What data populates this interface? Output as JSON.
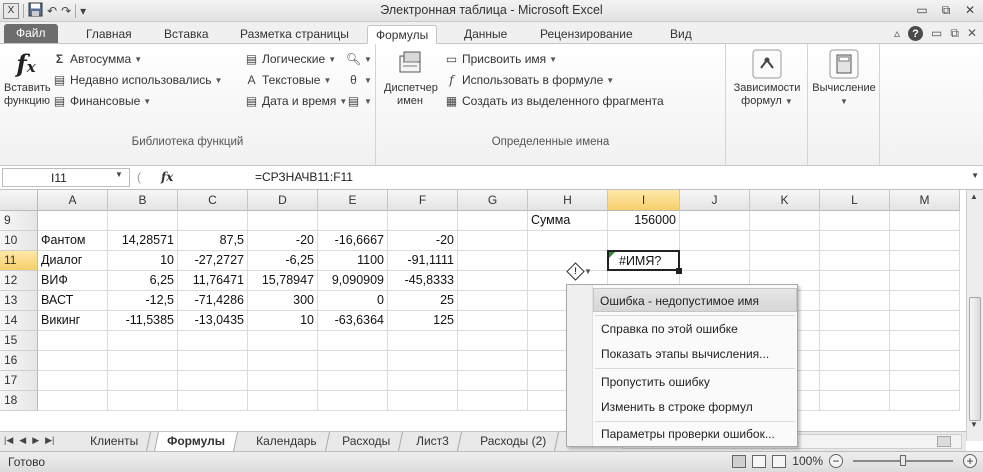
{
  "window": {
    "title": "Электронная таблица - Microsoft Excel",
    "qat": [
      {
        "icon": "excel-logo-icon",
        "glyph": "X"
      },
      {
        "icon": "save-icon",
        "glyph": "▪"
      },
      {
        "icon": "undo-icon",
        "glyph": "↶"
      },
      {
        "icon": "redo-icon",
        "glyph": "↷"
      },
      {
        "icon": "customize-qat-icon",
        "glyph": "▾"
      }
    ],
    "controls": {
      "minimize": "▭",
      "restore": "⧉",
      "close": "✕"
    }
  },
  "ribbon_tabs": {
    "file": "Файл",
    "home": "Главная",
    "insert": "Вставка",
    "page_layout": "Разметка страницы",
    "formulas": "Формулы",
    "data": "Данные",
    "review": "Рецензирование",
    "view": "Вид",
    "active": "Формулы"
  },
  "ribbon": {
    "insert_function": {
      "line1": "Вставить",
      "line2": "функцию"
    },
    "library": {
      "autosum": "Автосумма",
      "recent": "Недавно использовались",
      "financial": "Финансовые",
      "logical": "Логические",
      "text": "Текстовые",
      "datetime": "Дата и время",
      "label": "Библиотека функций"
    },
    "names": {
      "manager_line1": "Диспетчер",
      "manager_line2": "имен",
      "define": "Присвоить имя",
      "use_in_formula": "Использовать в формуле",
      "create_from_selection": "Создать из выделенного фрагмента",
      "label": "Определенные имена"
    },
    "auditing": {
      "line1": "Зависимости",
      "line2": "формул"
    },
    "calculation": {
      "line1": "Вычисление"
    }
  },
  "formula_bar": {
    "name_box": "I11",
    "fx": "fx",
    "formula": "=СРЗНАЧВ11:F11"
  },
  "columns": [
    "A",
    "B",
    "C",
    "D",
    "E",
    "F",
    "G",
    "H",
    "I",
    "J",
    "K",
    "L",
    "M"
  ],
  "rows": [
    {
      "num": "9",
      "cells": [
        "",
        "",
        "",
        "",
        "",
        "",
        "",
        "Сумма",
        "156000",
        "",
        "",
        "",
        ""
      ]
    },
    {
      "num": "10",
      "cells": [
        "Фантом",
        "14,28571",
        "87,5",
        "-20",
        "-16,6667",
        "-20",
        "",
        "",
        "",
        "",
        "",
        "",
        ""
      ]
    },
    {
      "num": "11",
      "cells": [
        "Диалог",
        "10",
        "-27,2727",
        "-6,25",
        "1100",
        "-91,1111",
        "",
        "",
        "#ИМЯ?",
        "",
        "",
        "",
        ""
      ]
    },
    {
      "num": "12",
      "cells": [
        "ВИФ",
        "6,25",
        "11,76471",
        "15,78947",
        "9,090909",
        "-45,8333",
        "",
        "",
        "",
        "",
        "",
        "",
        ""
      ]
    },
    {
      "num": "13",
      "cells": [
        "ВАСТ",
        "-12,5",
        "-71,4286",
        "300",
        "0",
        "25",
        "",
        "",
        "",
        "",
        "",
        "",
        ""
      ]
    },
    {
      "num": "14",
      "cells": [
        "Викинг",
        "-11,5385",
        "-13,0435",
        "10",
        "-63,6364",
        "125",
        "",
        "",
        "",
        "",
        "",
        "",
        ""
      ]
    },
    {
      "num": "15",
      "cells": [
        "",
        "",
        "",
        "",
        "",
        "",
        "",
        "",
        "",
        "",
        "",
        "",
        ""
      ]
    },
    {
      "num": "16",
      "cells": [
        "",
        "",
        "",
        "",
        "",
        "",
        "",
        "",
        "",
        "",
        "",
        "",
        ""
      ]
    },
    {
      "num": "17",
      "cells": [
        "",
        "",
        "",
        "",
        "",
        "",
        "",
        "",
        "",
        "",
        "",
        "",
        ""
      ]
    },
    {
      "num": "18",
      "cells": [
        "",
        "",
        "",
        "",
        "",
        "",
        "",
        "",
        "",
        "",
        "",
        "",
        ""
      ]
    }
  ],
  "active_cell": {
    "col": "I",
    "row": "11"
  },
  "error_menu": {
    "items": [
      "Ошибка - недопустимое имя",
      "Справка по этой ошибке",
      "Показать этапы вычисления...",
      "Пропустить ошибку",
      "Изменить в строке формул",
      "Параметры проверки ошибок..."
    ]
  },
  "sheets": [
    "Клиенты",
    "Формулы",
    "Календарь",
    "Расходы",
    "Лист3",
    "Расходы (2)"
  ],
  "active_sheet": "Формулы",
  "status": {
    "ready": "Готово",
    "zoom": "100%"
  }
}
